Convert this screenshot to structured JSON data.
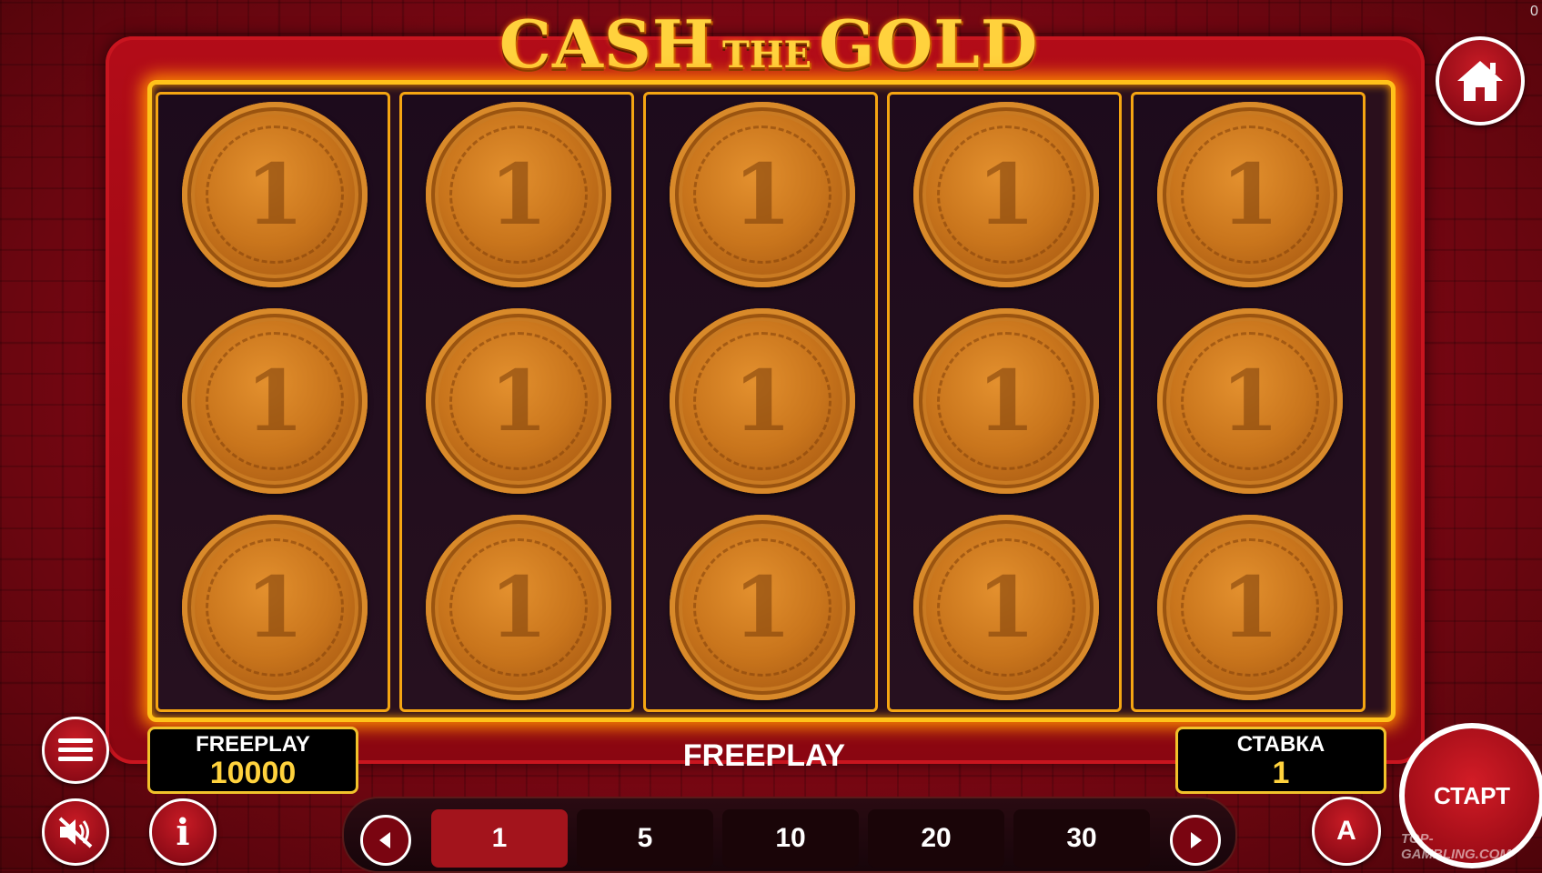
{
  "game": {
    "title_cash": "CASH",
    "title_the": "THE",
    "title_gold": "GOLD"
  },
  "reels": [
    [
      "1",
      "1",
      "1"
    ],
    [
      "1",
      "1",
      "1"
    ],
    [
      "1",
      "1",
      "1"
    ],
    [
      "1",
      "1",
      "1"
    ],
    [
      "1",
      "1",
      "1"
    ]
  ],
  "balance": {
    "label": "FREEPLAY",
    "value": "10000"
  },
  "status": {
    "text": "FREEPLAY"
  },
  "bet": {
    "label": "СТАВКА",
    "value": "1"
  },
  "bet_options": [
    "1",
    "5",
    "10",
    "20",
    "30"
  ],
  "bet_selected": "1",
  "start": {
    "label": "СТАРТ"
  },
  "autoplay": {
    "label": "A"
  },
  "info": {
    "label": "i"
  },
  "watermark": {
    "text": "TOP-GAMBLING.COM"
  },
  "corner_text": "0",
  "icons": {
    "home": "home-icon",
    "menu": "menu-icon",
    "sound": "sound-muted-icon",
    "info": "info-icon",
    "autoplay": "autoplay-icon",
    "prev": "arrow-left-icon",
    "next": "arrow-right-icon"
  },
  "colors": {
    "accent": "#ffc21a",
    "panel": "#a3141c",
    "value": "#ffd23d"
  }
}
